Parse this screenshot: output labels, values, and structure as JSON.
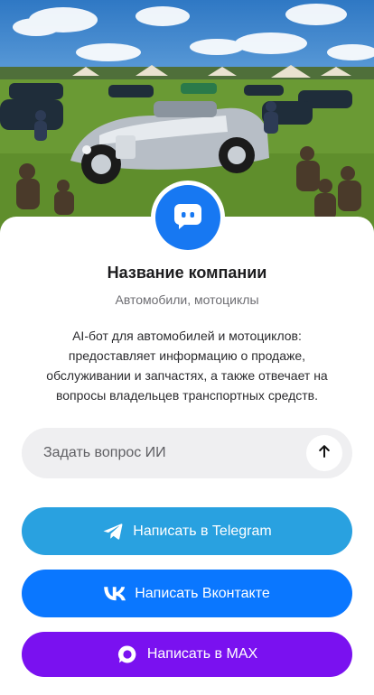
{
  "hero": {
    "image": "vintage car show illustration",
    "sky_color": "#4a8fd4",
    "grass_color": "#6a9a34"
  },
  "profile": {
    "avatar_icon": "chat-bubble-icon",
    "company_name": "Название компании",
    "category": "Автомобили, мотоциклы",
    "description": "AI-бот для автомобилей и мотоциклов: предоставляет информацию о продаже, обслуживании и запчастях, а также отвечает на вопросы владельцев транспортных средств."
  },
  "ask": {
    "placeholder": "Задать вопрос ИИ",
    "value": "",
    "send_icon": "arrow-up-icon"
  },
  "buttons": {
    "telegram": {
      "label": "Написать в Telegram",
      "icon": "telegram-icon",
      "color": "#29a1e0"
    },
    "vk": {
      "label": "Написать Вконтакте",
      "icon": "vk-icon",
      "color": "#0a77ff"
    },
    "max": {
      "label": "Написать в MAX",
      "icon": "max-icon",
      "color": "#7a11f0"
    }
  }
}
